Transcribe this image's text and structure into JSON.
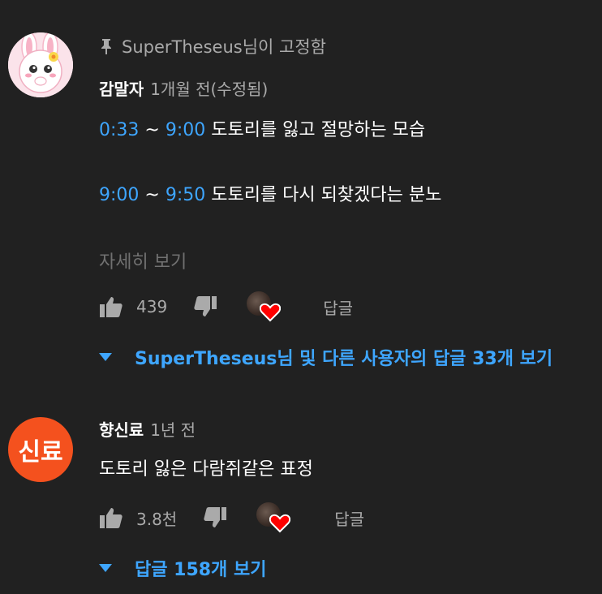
{
  "comments": [
    {
      "pinned_label": "SuperTheseus님이 고정함",
      "author": "감말자",
      "time": "1개월 전(수정됨)",
      "lines": [
        {
          "ts_start": "0:33",
          "sep": " ~ ",
          "ts_end": "9:00",
          "text": " 도토리를 잃고 절망하는 모습"
        },
        {
          "ts_start": "9:00",
          "sep": " ~ ",
          "ts_end": "9:50",
          "text": " 도토리를 다시 되찾겠다는 분노"
        }
      ],
      "read_more": "자세히 보기",
      "likes": "439",
      "reply_label": "답글",
      "replies_label": "SuperTheseus님 및 다른 사용자의 답글 33개 보기"
    },
    {
      "avatar_text": "신료",
      "author": "향신료",
      "time": "1년 전",
      "text": "도토리 잃은 다람쥐같은 표정",
      "likes": "3.8천",
      "reply_label": "답글",
      "replies_label": "답글 158개 보기"
    }
  ],
  "icons": {
    "pin": "pin-icon",
    "like": "thumb-up-icon",
    "dislike": "thumb-down-icon",
    "heart": "heart-icon",
    "caret": "caret-down-icon"
  },
  "colors": {
    "background": "#212121",
    "link": "#3ea6ff",
    "secondary_text": "#aaaaaa",
    "primary_text": "#ffffff",
    "avatar_orange": "#f4511e",
    "heart_red": "#ff0000"
  }
}
